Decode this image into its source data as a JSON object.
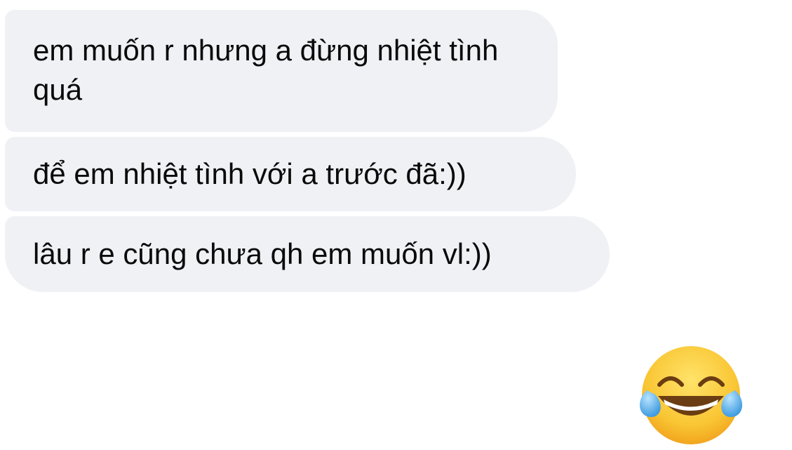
{
  "messages": [
    {
      "sender": "other",
      "text": "em muốn r nhưng a đừng nhiệt tình quá"
    },
    {
      "sender": "other",
      "text": "để em nhiệt tình với a trước đã:))"
    },
    {
      "sender": "other",
      "text": "lâu r e cũng chưa qh em muốn vl:))"
    }
  ],
  "reaction": {
    "icon": "tears-of-joy-emoji-icon"
  },
  "colors": {
    "background": "#ffffff",
    "bubble": "#f0f1f5",
    "text": "#0a0a0a",
    "emoji_face": "#f9c634",
    "emoji_tear": "#5fb7f0"
  }
}
